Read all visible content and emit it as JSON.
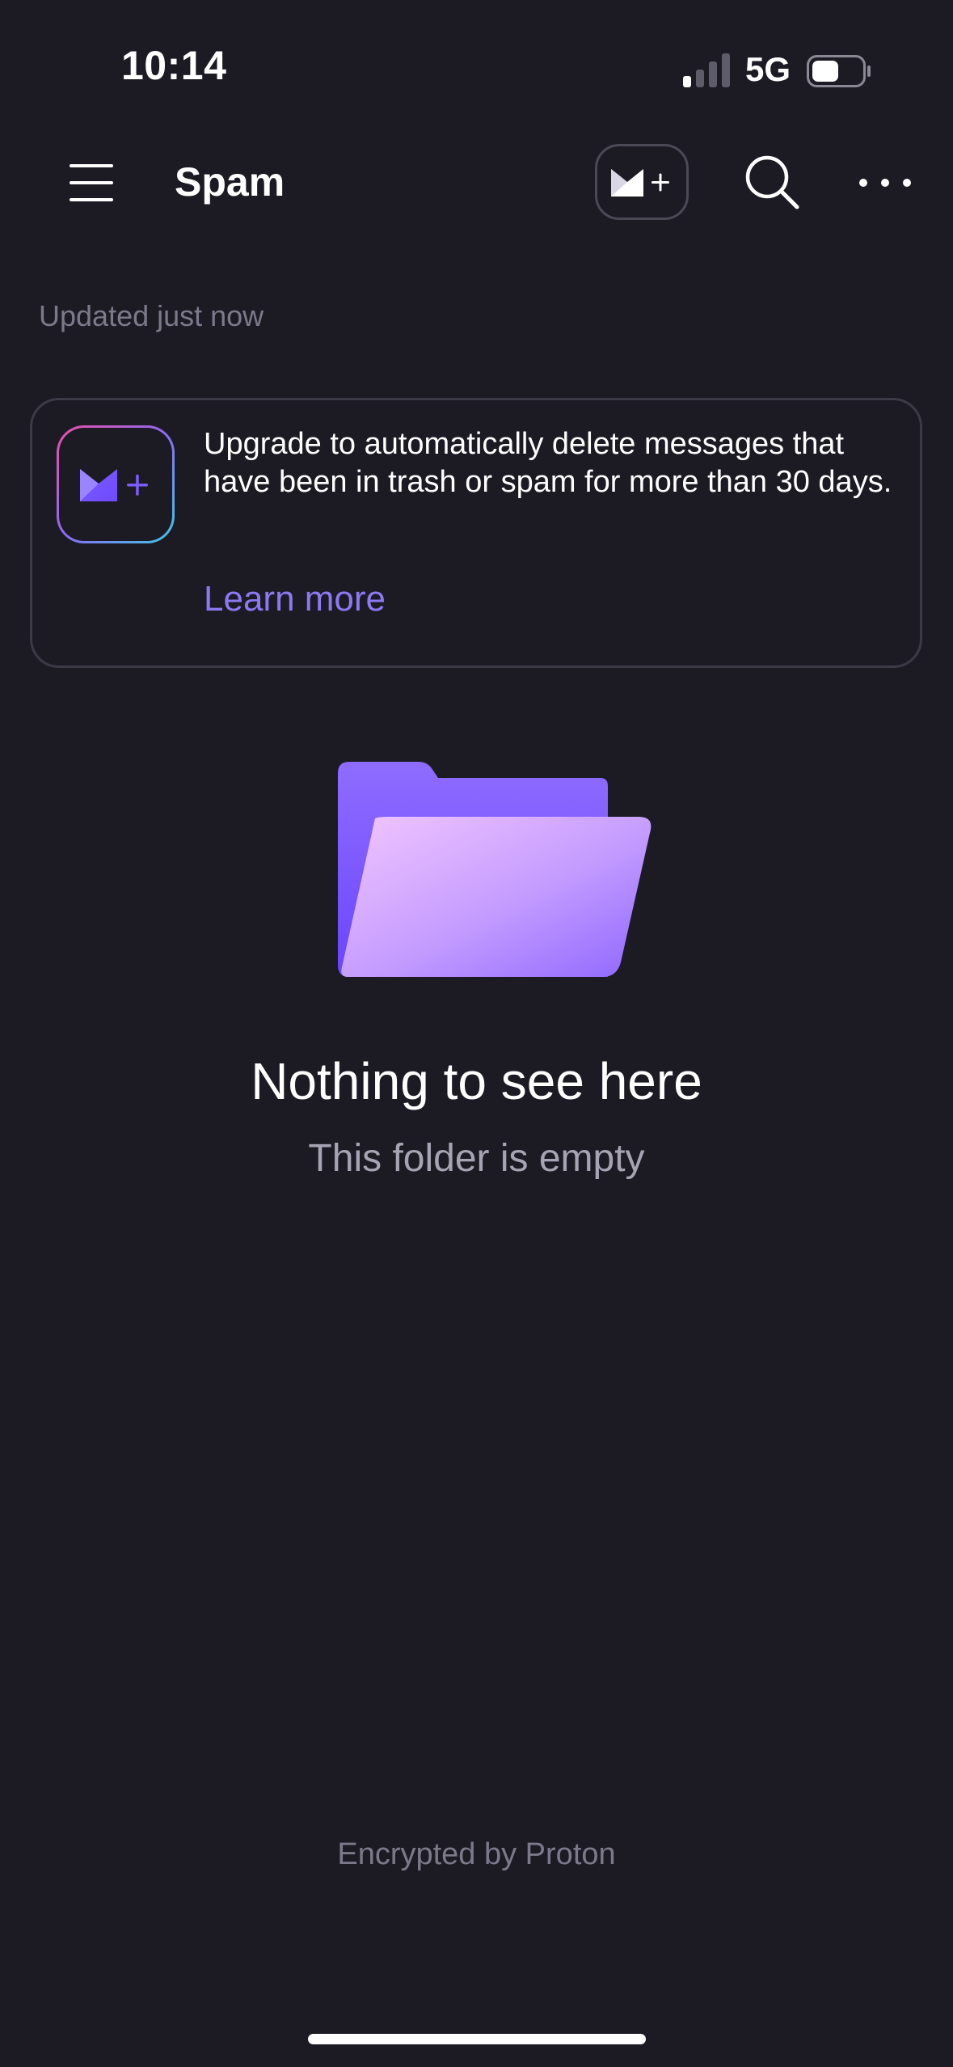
{
  "status_bar": {
    "time": "10:14",
    "network": "5G",
    "battery_level": 0.45
  },
  "header": {
    "title": "Spam",
    "icons": {
      "menu": "hamburger-menu-icon",
      "upgrade": "mail-plus-icon",
      "search": "search-icon",
      "more": "more-horizontal-icon"
    }
  },
  "updated_text": "Updated just now",
  "banner": {
    "text": "Upgrade to automatically delete messages that have been in trash or spam for more than 30 days.",
    "link": "Learn more",
    "colors": {
      "link": "#8d78f2",
      "gradient_pink": "#ec4fa8",
      "gradient_cyan": "#3ec6e6"
    }
  },
  "empty_state": {
    "title": "Nothing to see here",
    "subtitle": "This folder is empty",
    "icon": "folder-icon"
  },
  "footer": "Encrypted by Proton",
  "colors": {
    "background": "#1c1b24",
    "accent": "#6d4aff",
    "muted_text": "#7c7a8a"
  }
}
